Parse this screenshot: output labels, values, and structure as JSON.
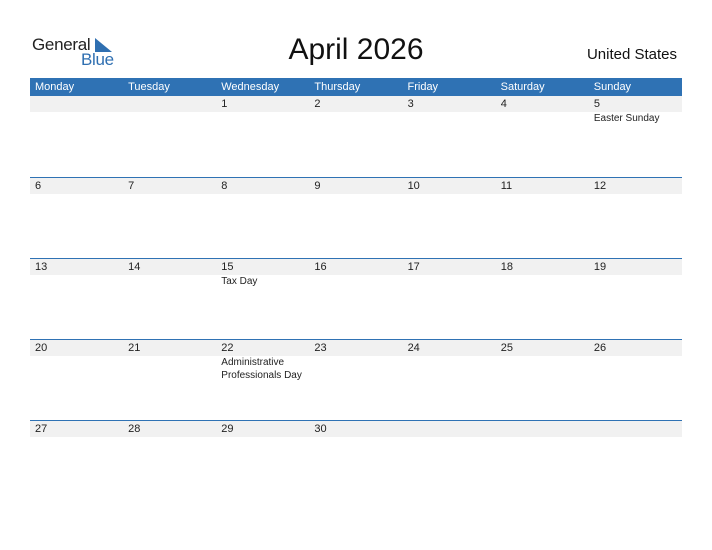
{
  "logo": {
    "line1": "General",
    "line2": "Blue",
    "icon": "triangle-flag-icon"
  },
  "title": "April 2026",
  "country": "United States",
  "colors": {
    "accent": "#2f72b4",
    "strip": "#f1f1f1"
  },
  "weekdays": [
    "Monday",
    "Tuesday",
    "Wednesday",
    "Thursday",
    "Friday",
    "Saturday",
    "Sunday"
  ],
  "weeks": [
    [
      {
        "day": ""
      },
      {
        "day": ""
      },
      {
        "day": "1"
      },
      {
        "day": "2"
      },
      {
        "day": "3"
      },
      {
        "day": "4"
      },
      {
        "day": "5",
        "event": "Easter Sunday"
      }
    ],
    [
      {
        "day": "6"
      },
      {
        "day": "7"
      },
      {
        "day": "8"
      },
      {
        "day": "9"
      },
      {
        "day": "10"
      },
      {
        "day": "11"
      },
      {
        "day": "12"
      }
    ],
    [
      {
        "day": "13"
      },
      {
        "day": "14"
      },
      {
        "day": "15",
        "event": "Tax Day"
      },
      {
        "day": "16"
      },
      {
        "day": "17"
      },
      {
        "day": "18"
      },
      {
        "day": "19"
      }
    ],
    [
      {
        "day": "20"
      },
      {
        "day": "21"
      },
      {
        "day": "22",
        "event": "Administrative Professionals Day"
      },
      {
        "day": "23"
      },
      {
        "day": "24"
      },
      {
        "day": "25"
      },
      {
        "day": "26"
      }
    ],
    [
      {
        "day": "27"
      },
      {
        "day": "28"
      },
      {
        "day": "29"
      },
      {
        "day": "30"
      },
      {
        "day": ""
      },
      {
        "day": ""
      },
      {
        "day": ""
      }
    ]
  ]
}
